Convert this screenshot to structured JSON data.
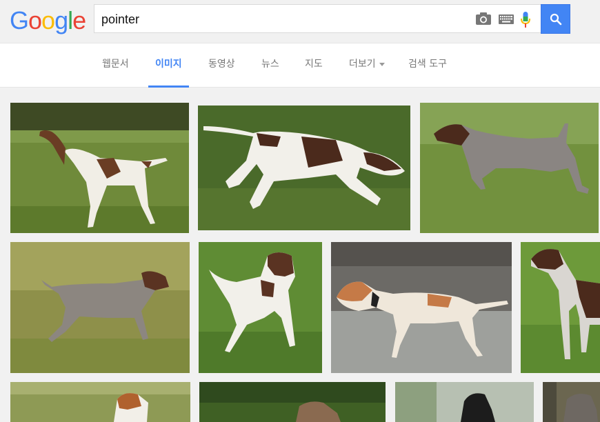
{
  "header": {
    "logo": [
      "G",
      "o",
      "o",
      "g",
      "l",
      "e"
    ],
    "logo_colors": [
      "#4285f4",
      "#ea4335",
      "#fbbc05",
      "#4285f4",
      "#34a853",
      "#ea4335"
    ],
    "search_value": "pointer",
    "search_button_icon": "search-icon"
  },
  "nav": {
    "tabs": [
      {
        "label": "웹문서",
        "active": false
      },
      {
        "label": "이미지",
        "active": true
      },
      {
        "label": "동영상",
        "active": false
      },
      {
        "label": "뉴스",
        "active": false
      },
      {
        "label": "지도",
        "active": false
      },
      {
        "label": "더보기",
        "active": false
      },
      {
        "label": "검색 도구",
        "active": false
      }
    ]
  },
  "colors": {
    "accent": "#4285f4",
    "grass": "#6f8f3a",
    "dog_brown": "#5a3322"
  },
  "images": [
    {
      "alt": "brown and white pointer standing in field"
    },
    {
      "alt": "pointer walking in grass"
    },
    {
      "alt": "german shorthaired pointer in grass"
    },
    {
      "alt": "roan pointer pointing in field"
    },
    {
      "alt": "white and liver pointer facing camera"
    },
    {
      "alt": "orange and white pointer in water"
    },
    {
      "alt": "shorthaired pointer standing"
    },
    {
      "alt": "pointer puppy in tall grass"
    },
    {
      "alt": "pointer lying in grass"
    },
    {
      "alt": "black pointer head"
    },
    {
      "alt": "grey pointer head"
    }
  ]
}
